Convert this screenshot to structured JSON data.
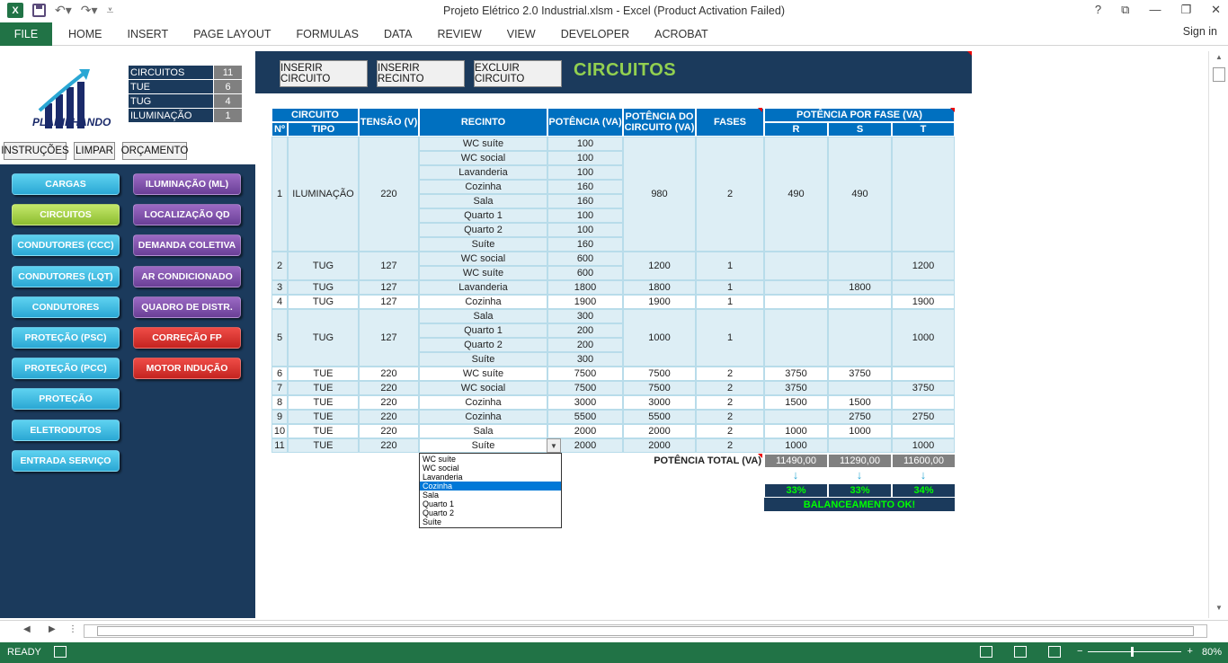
{
  "window": {
    "title": "Projeto Elétrico 2.0 Industrial.xlsm - Excel (Product Activation Failed)",
    "controls": [
      "?",
      "⧉",
      "—",
      "❐",
      "✕"
    ]
  },
  "ribbon": {
    "file": "FILE",
    "tabs": [
      "HOME",
      "INSERT",
      "PAGE LAYOUT",
      "FORMULAS",
      "DATA",
      "REVIEW",
      "VIEW",
      "DEVELOPER",
      "ACROBAT"
    ],
    "sign_in": "Sign in"
  },
  "logo_text": "PLANILHANDO",
  "summary": [
    {
      "label": "CIRCUITOS",
      "value": "11"
    },
    {
      "label": "TUE",
      "value": "6"
    },
    {
      "label": "TUG",
      "value": "4"
    },
    {
      "label": "ILUMINAÇÃO",
      "value": "1"
    }
  ],
  "top_buttons": [
    "INSTRUÇÕES",
    "LIMPAR",
    "ORÇAMENTO"
  ],
  "nav_left": [
    "CARGAS",
    "CIRCUITOS",
    "CONDUTORES (CCC)",
    "CONDUTORES (LQT)",
    "CONDUTORES",
    "PROTEÇÃO (PSC)",
    "PROTEÇÃO (PCC)",
    "PROTEÇÃO",
    "ELETRODUTOS",
    "ENTRADA SERVIÇO"
  ],
  "nav_right": [
    "ILUMINAÇÃO (ML)",
    "LOCALIZAÇÃO QD",
    "DEMANDA COLETIVA",
    "AR CONDICIONADO",
    "QUADRO DE DISTR.",
    "CORREÇÃO FP",
    "MOTOR INDUÇÃO"
  ],
  "header_buttons": [
    "INSERIR CIRCUITO",
    "INSERIR RECINTO",
    "EXCLUIR CIRCUITO"
  ],
  "section_title": "CIRCUITOS",
  "table": {
    "headers": {
      "circuito": "CIRCUITO",
      "n": "Nº",
      "tipo": "TIPO",
      "tensao": "TENSÃO (V)",
      "recinto": "RECINTO",
      "potencia": "POTÊNCIA (VA)",
      "potencia_circuito": "POTÊNCIA DO CIRCUITO (VA)",
      "fases": "FASES",
      "por_fase": "POTÊNCIA POR FASE (VA)",
      "r": "R",
      "s": "S",
      "t": "T"
    },
    "circuits": [
      {
        "n": "1",
        "tipo": "ILUMINAÇÃO",
        "tensao": "220",
        "recintos": [
          [
            "WC suíte",
            "100"
          ],
          [
            "WC social",
            "100"
          ],
          [
            "Lavanderia",
            "100"
          ],
          [
            "Cozinha",
            "160"
          ],
          [
            "Sala",
            "160"
          ],
          [
            "Quarto 1",
            "100"
          ],
          [
            "Quarto 2",
            "100"
          ],
          [
            "Suíte",
            "160"
          ]
        ],
        "total": "980",
        "fases": "2",
        "r": "490",
        "s": "490",
        "t": ""
      },
      {
        "n": "2",
        "tipo": "TUG",
        "tensao": "127",
        "recintos": [
          [
            "WC social",
            "600"
          ],
          [
            "WC suíte",
            "600"
          ]
        ],
        "total": "1200",
        "fases": "1",
        "r": "",
        "s": "",
        "t": "1200"
      },
      {
        "n": "3",
        "tipo": "TUG",
        "tensao": "127",
        "recintos": [
          [
            "Lavanderia",
            "1800"
          ]
        ],
        "total": "1800",
        "fases": "1",
        "r": "",
        "s": "1800",
        "t": ""
      },
      {
        "n": "4",
        "tipo": "TUG",
        "tensao": "127",
        "recintos": [
          [
            "Cozinha",
            "1900"
          ]
        ],
        "total": "1900",
        "fases": "1",
        "r": "",
        "s": "",
        "t": "1900"
      },
      {
        "n": "5",
        "tipo": "TUG",
        "tensao": "127",
        "recintos": [
          [
            "Sala",
            "300"
          ],
          [
            "Quarto 1",
            "200"
          ],
          [
            "Quarto 2",
            "200"
          ],
          [
            "Suíte",
            "300"
          ]
        ],
        "total": "1000",
        "fases": "1",
        "r": "",
        "s": "",
        "t": "1000"
      },
      {
        "n": "6",
        "tipo": "TUE",
        "tensao": "220",
        "recintos": [
          [
            "WC suíte",
            "7500"
          ]
        ],
        "total": "7500",
        "fases": "2",
        "r": "3750",
        "s": "3750",
        "t": ""
      },
      {
        "n": "7",
        "tipo": "TUE",
        "tensao": "220",
        "recintos": [
          [
            "WC social",
            "7500"
          ]
        ],
        "total": "7500",
        "fases": "2",
        "r": "3750",
        "s": "",
        "t": "3750"
      },
      {
        "n": "8",
        "tipo": "TUE",
        "tensao": "220",
        "recintos": [
          [
            "Cozinha",
            "3000"
          ]
        ],
        "total": "3000",
        "fases": "2",
        "r": "1500",
        "s": "1500",
        "t": ""
      },
      {
        "n": "9",
        "tipo": "TUE",
        "tensao": "220",
        "recintos": [
          [
            "Cozinha",
            "5500"
          ]
        ],
        "total": "5500",
        "fases": "2",
        "r": "",
        "s": "2750",
        "t": "2750"
      },
      {
        "n": "10",
        "tipo": "TUE",
        "tensao": "220",
        "recintos": [
          [
            "Sala",
            "2000"
          ]
        ],
        "total": "2000",
        "fases": "2",
        "r": "1000",
        "s": "1000",
        "t": ""
      },
      {
        "n": "11",
        "tipo": "TUE",
        "tensao": "220",
        "recintos": [
          [
            "Suíte",
            "2000"
          ]
        ],
        "total": "2000",
        "fases": "2",
        "r": "1000",
        "s": "",
        "t": "1000"
      }
    ],
    "total_label": "POTÊNCIA TOTAL (VA)",
    "totals": {
      "r": "11490,00",
      "s": "11290,00",
      "t": "11600,00"
    },
    "percents": {
      "r": "33%",
      "s": "33%",
      "t": "34%"
    },
    "balance": "BALANCEAMENTO OK!"
  },
  "dropdown": {
    "options": [
      "WC suíte",
      "WC social",
      "Lavanderia",
      "Cozinha",
      "Sala",
      "Quarto 1",
      "Quarto 2",
      "Suíte"
    ],
    "selected": "Cozinha"
  },
  "status": {
    "ready": "READY",
    "zoom": "80%"
  },
  "colors": {
    "excel_green": "#217346",
    "sidebar_navy": "#1b3a5c",
    "header_blue": "#0070c0",
    "row_blue": "#ddeef5",
    "balance_green": "#00ff00",
    "title_green": "#92d050"
  }
}
